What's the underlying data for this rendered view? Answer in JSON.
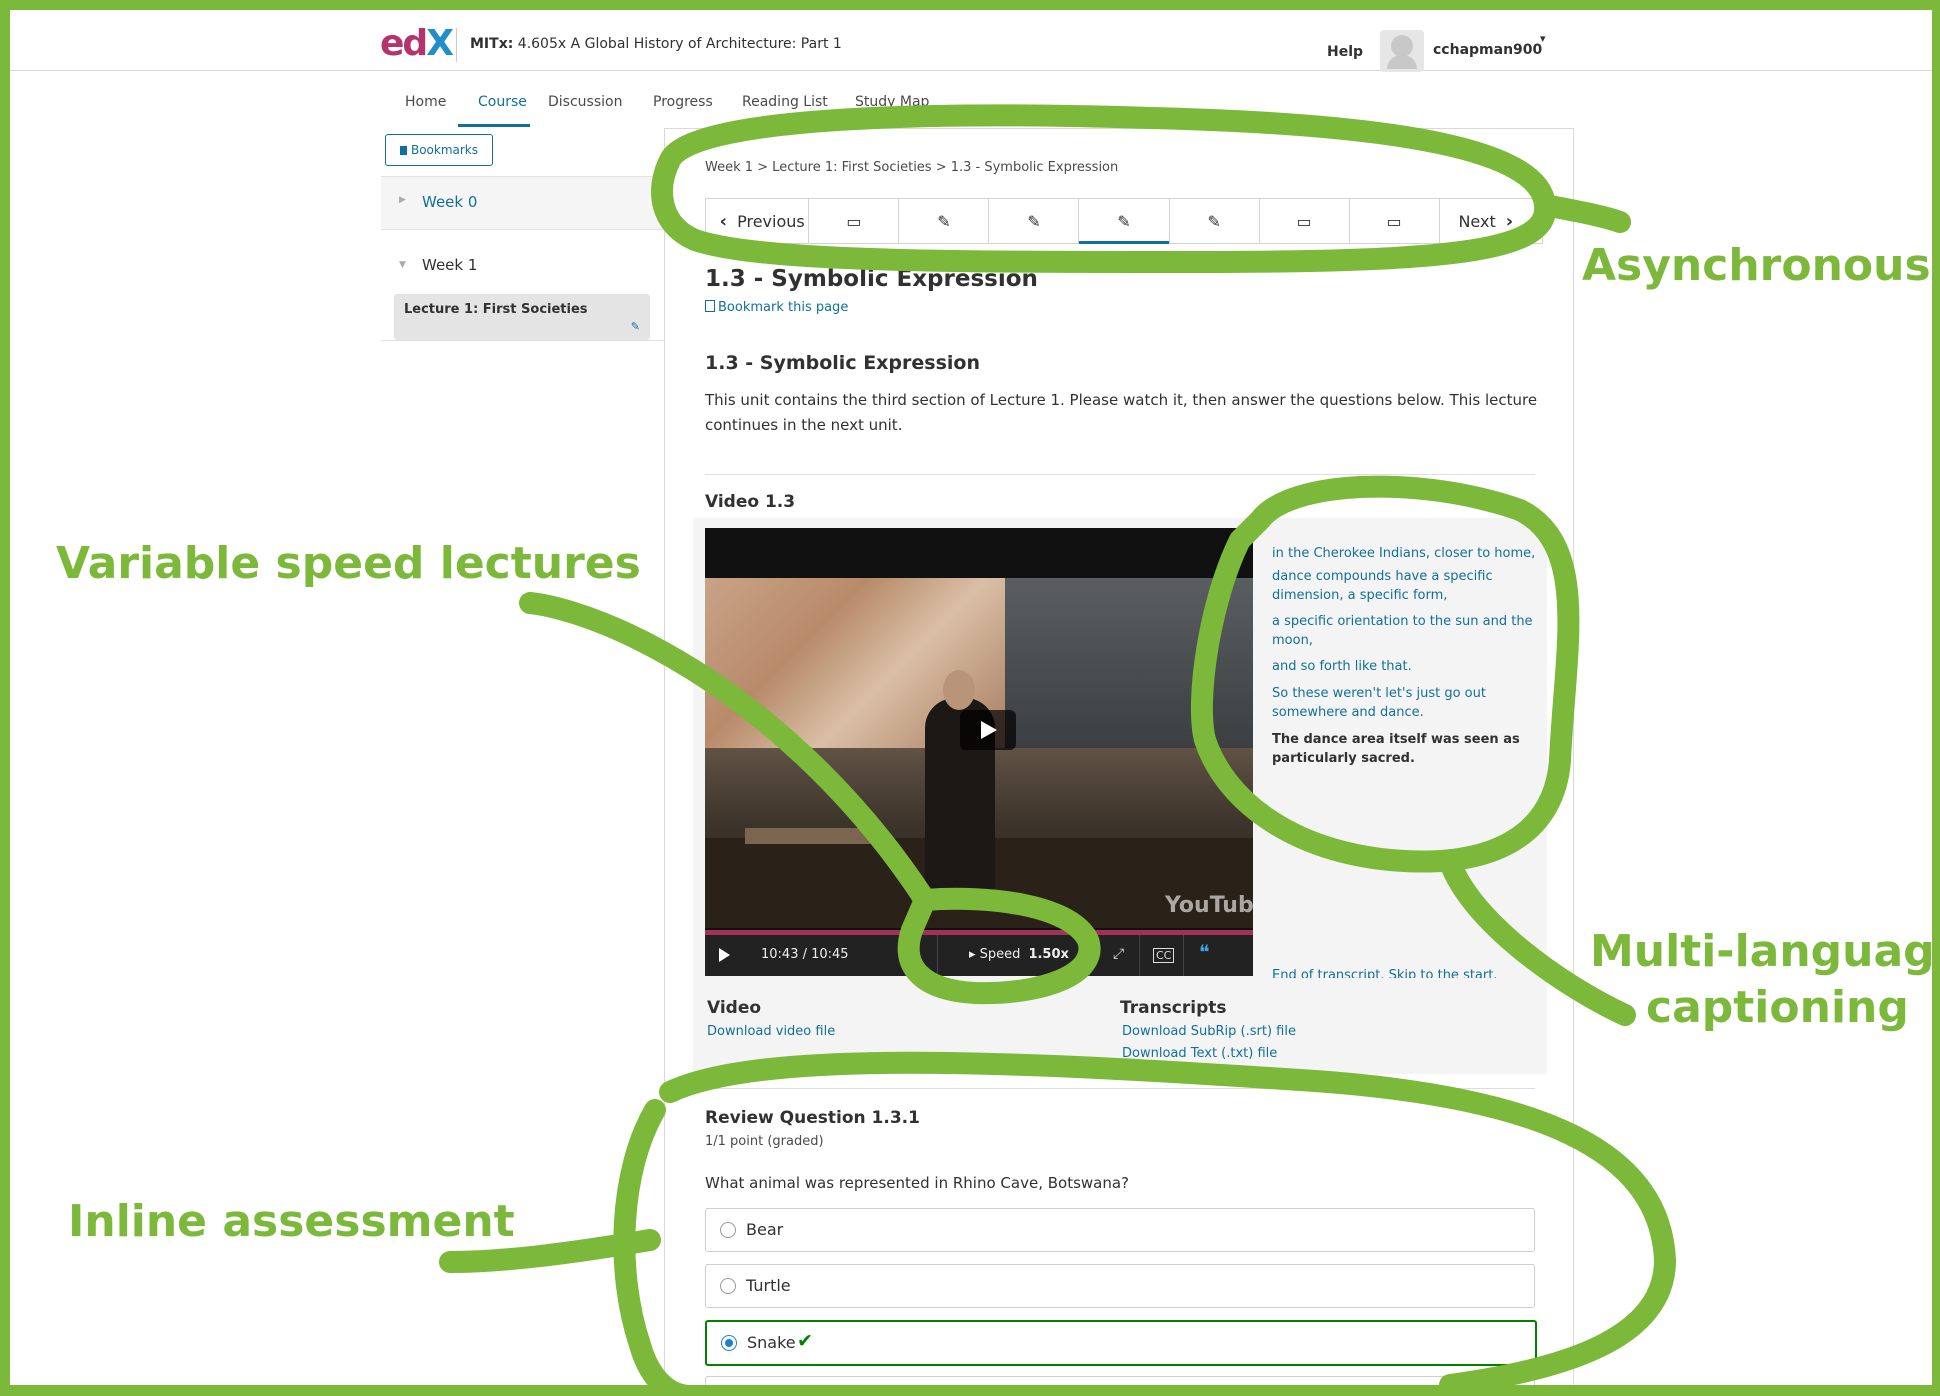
{
  "header": {
    "logo": {
      "e": "e",
      "d": "d",
      "x": "X"
    },
    "course_org": "MITx:",
    "course_name": "4.605x A Global History of Architecture: Part 1",
    "help": "Help",
    "username": "cchapman900",
    "caret": "▾"
  },
  "tabs": [
    "Home",
    "Course",
    "Discussion",
    "Progress",
    "Reading List",
    "Study Map"
  ],
  "active_tab": "Course",
  "sidebar": {
    "bookmarks_label": "Bookmarks",
    "weeks": [
      {
        "label": "Week 0",
        "expanded": false
      },
      {
        "label": "Week 1",
        "expanded": true
      }
    ],
    "current_lecture": "Lecture 1: First Societies"
  },
  "breadcrumb": "Week 1 > Lecture 1: First Societies > 1.3 - Symbolic Expression",
  "sequence_nav": {
    "previous": "Previous",
    "next": "Next",
    "items": [
      "book-icon",
      "edit-icon",
      "edit-icon",
      "edit-icon",
      "edit-icon",
      "book-icon",
      "book-icon"
    ],
    "active_index": 3
  },
  "unit": {
    "title": "1.3 - Symbolic Expression",
    "bookmark_link": "Bookmark this page",
    "section_title": "1.3 - Symbolic Expression",
    "description": "This unit contains the third section of Lecture 1. Please watch it, then answer the questions below. This lecture continues in the next unit."
  },
  "video": {
    "heading": "Video 1.3",
    "time": "10:43 / 10:45",
    "speed_label": "Speed",
    "speed_value": "1.50x",
    "youtube_mark": "YouTube",
    "transcript": [
      "in the Cherokee Indians, closer to home,",
      "dance compounds have a specific dimension, a specific form,",
      "a specific orientation to the sun and the moon,",
      "and so forth like that.",
      "So these weren't let's just go out somewhere and dance.",
      "The dance area itself was seen as particularly sacred."
    ],
    "transcript_current_index": 5,
    "transcript_footer": "End of transcript. Skip to the start.",
    "download_video_heading": "Video",
    "download_video_link": "Download video file",
    "transcripts_heading": "Transcripts",
    "download_srt": "Download SubRip (.srt) file",
    "download_txt": "Download Text (.txt) file"
  },
  "question": {
    "title": "Review Question 1.3.1",
    "points": "1/1 point (graded)",
    "text": "What animal was represented in Rhino Cave, Botswana?",
    "options": [
      "Bear",
      "Turtle",
      "Snake"
    ],
    "selected": "Snake",
    "correct_mark": "✔"
  },
  "annotations": {
    "asynchronous": "Asynchronous",
    "variable_speed": "Variable speed lectures",
    "multi_language_1": "Multi-language",
    "multi_language_2": "captioning",
    "inline_assessment": "Inline assessment",
    "color": "#7cb83a"
  },
  "colors": {
    "link": "#126f9a",
    "correct": "#008100",
    "progress": "#a0325a"
  }
}
